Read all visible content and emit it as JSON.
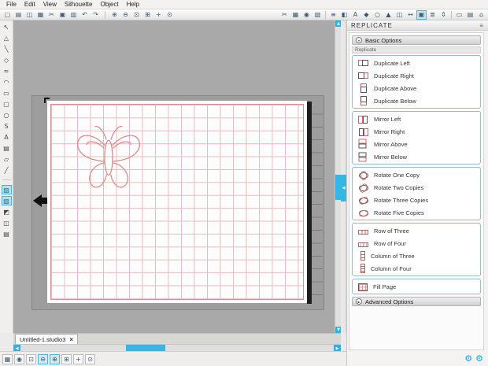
{
  "colors": {
    "accent": "#2fb0dd",
    "grid_line": "#e7bcbc",
    "design_outline": "#d98b8b",
    "canvas_bg": "#a9a9a9",
    "mat": "#9d9d9d"
  },
  "menu": {
    "items": [
      {
        "label": "File"
      },
      {
        "label": "Edit"
      },
      {
        "label": "View"
      },
      {
        "label": "Silhouette"
      },
      {
        "label": "Object"
      },
      {
        "label": "Help"
      }
    ]
  },
  "toolbar": {
    "file_icons": [
      {
        "name": "new-document",
        "glyph": "▢"
      },
      {
        "name": "open-file",
        "glyph": "▤"
      },
      {
        "name": "save",
        "glyph": "◫"
      },
      {
        "name": "print",
        "glyph": "▦"
      },
      {
        "name": "cut",
        "glyph": "✂"
      },
      {
        "name": "copy",
        "glyph": "▣"
      },
      {
        "name": "paste",
        "glyph": "▥"
      },
      {
        "name": "undo",
        "glyph": "↶"
      },
      {
        "name": "redo",
        "glyph": "↷"
      }
    ],
    "zoom_icons": [
      {
        "name": "zoom-in",
        "glyph": "⊕"
      },
      {
        "name": "zoom-out",
        "glyph": "⊖"
      },
      {
        "name": "zoom-selection",
        "glyph": "⊡"
      },
      {
        "name": "drag-zoom",
        "glyph": "⊞"
      },
      {
        "name": "pan",
        "glyph": "+"
      },
      {
        "name": "fit-to-page",
        "glyph": "⊙"
      }
    ],
    "right_icons": [
      {
        "name": "send-to-silhouette",
        "glyph": "✂"
      },
      {
        "name": "page-settings",
        "glyph": "▦"
      },
      {
        "name": "registration-marks",
        "glyph": "◉"
      },
      {
        "name": "pixscan",
        "glyph": "▧"
      },
      {
        "name": "line-style",
        "glyph": "≡"
      },
      {
        "name": "fill-style",
        "glyph": "◧"
      },
      {
        "name": "text-style",
        "glyph": "A"
      },
      {
        "name": "image-effects",
        "glyph": "◆"
      },
      {
        "name": "offset",
        "glyph": "○"
      },
      {
        "name": "trace",
        "glyph": "▲"
      },
      {
        "name": "modify",
        "glyph": "◫"
      },
      {
        "name": "transform",
        "glyph": "↔"
      },
      {
        "name": "replicate",
        "glyph": "▣"
      },
      {
        "name": "align",
        "glyph": "≣"
      },
      {
        "name": "scale",
        "glyph": "⇕"
      },
      {
        "name": "object-properties",
        "glyph": "▭"
      },
      {
        "name": "library",
        "glyph": "▤"
      },
      {
        "name": "store",
        "glyph": "⌂"
      }
    ]
  },
  "left_tools": {
    "drawing": [
      {
        "name": "select-tool",
        "glyph": "↖"
      },
      {
        "name": "edit-points-tool",
        "glyph": "△"
      },
      {
        "name": "line-tool",
        "glyph": "╲"
      },
      {
        "name": "polygon-tool",
        "glyph": "◇"
      },
      {
        "name": "curve-tool",
        "glyph": "≈"
      },
      {
        "name": "arc-tool",
        "glyph": "◠"
      },
      {
        "name": "rectangle-tool",
        "glyph": "▭"
      },
      {
        "name": "rounded-rectangle-tool",
        "glyph": "▢"
      },
      {
        "name": "ellipse-tool",
        "glyph": "○"
      },
      {
        "name": "freehand-tool",
        "glyph": "S"
      },
      {
        "name": "text-tool",
        "glyph": "A"
      },
      {
        "name": "note-tool",
        "glyph": "▤"
      },
      {
        "name": "eraser-tool",
        "glyph": "▱"
      },
      {
        "name": "knife-tool",
        "glyph": "╱"
      }
    ],
    "panels": [
      {
        "name": "fill-panel",
        "glyph": "▨"
      },
      {
        "name": "line-color-panel",
        "glyph": "▧"
      },
      {
        "name": "effects-panel",
        "glyph": "◩"
      },
      {
        "name": "layers-panel",
        "glyph": "◫"
      },
      {
        "name": "library-panel",
        "glyph": "▤"
      }
    ]
  },
  "scrollbars": {
    "up_glyph": "▲",
    "down_glyph": "▼",
    "left_glyph": "◀",
    "right_glyph": "▶",
    "grip_glyph": "◀"
  },
  "tabbar": {
    "tab_label": "Untitled-1.studio3",
    "close_glyph": "×"
  },
  "bottombar": {
    "icons": [
      {
        "name": "show-grid",
        "glyph": "▦"
      },
      {
        "name": "snap-to-grid",
        "glyph": "◉"
      },
      {
        "name": "show-registration",
        "glyph": "⊡"
      },
      {
        "name": "zoom-out",
        "glyph": "⊖"
      },
      {
        "name": "zoom-in",
        "glyph": "⊕"
      },
      {
        "name": "drag-zoom",
        "glyph": "⊞"
      },
      {
        "name": "pan-tool",
        "glyph": "+"
      },
      {
        "name": "fit-page",
        "glyph": "⊙"
      }
    ]
  },
  "panel": {
    "title": "REPLICATE",
    "menu_glyph": "≡",
    "basic_header": "Basic Options",
    "basic_arrow": "▼",
    "sub_label": "Replicate",
    "advanced_header": "Advanced Options",
    "advanced_arrow": "▶",
    "groups": [
      {
        "items": [
          {
            "label": "Duplicate Left"
          },
          {
            "label": "Duplicate Right"
          },
          {
            "label": "Duplicate Above"
          },
          {
            "label": "Duplicate Below"
          }
        ]
      },
      {
        "items": [
          {
            "label": "Mirror Left"
          },
          {
            "label": "Mirror Right"
          },
          {
            "label": "Mirror Above"
          },
          {
            "label": "Mirror Below"
          }
        ]
      },
      {
        "items": [
          {
            "label": "Rotate One Copy"
          },
          {
            "label": "Rotate Two Copies"
          },
          {
            "label": "Rotate Three Copies"
          },
          {
            "label": "Rotate Five Copies"
          }
        ]
      },
      {
        "items": [
          {
            "label": "Row of Three"
          },
          {
            "label": "Row of Four"
          },
          {
            "label": "Column of Three"
          },
          {
            "label": "Column of Four"
          }
        ]
      },
      {
        "items": [
          {
            "label": "Fill Page"
          }
        ]
      }
    ],
    "gears": [
      {
        "name": "preferences-gear",
        "glyph": "⚙"
      },
      {
        "name": "theme-gear",
        "glyph": "⚙"
      }
    ]
  }
}
